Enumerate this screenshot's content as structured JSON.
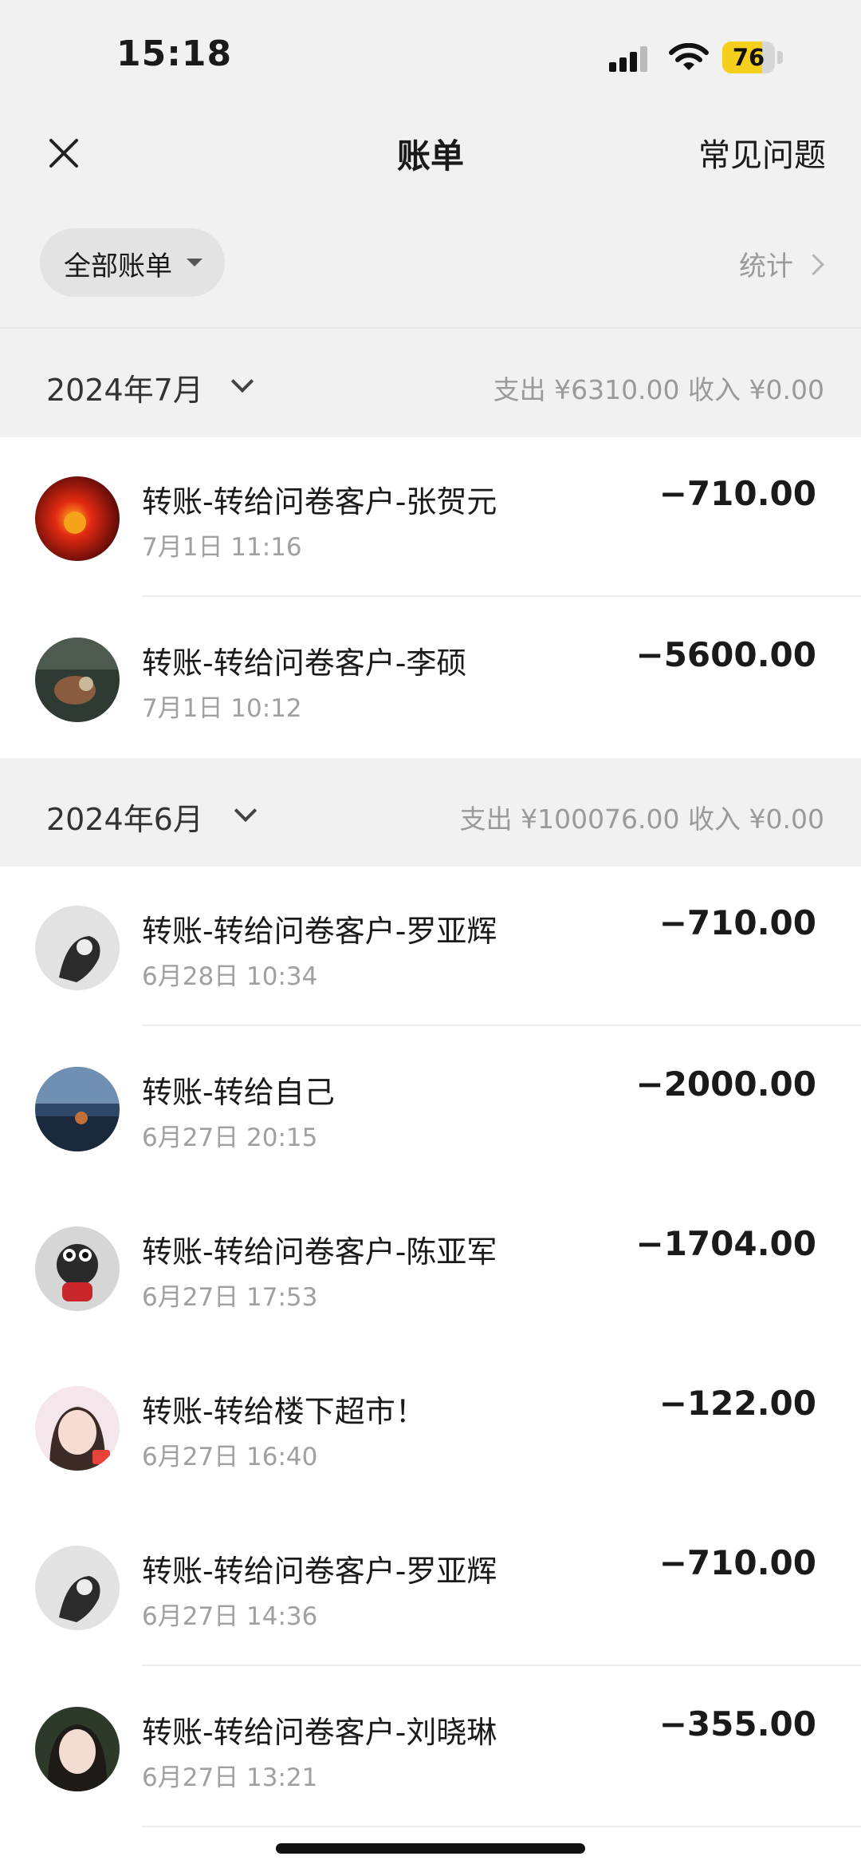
{
  "status_bar": {
    "time": "15:18",
    "battery": "76",
    "battery_level": 0.76
  },
  "nav": {
    "title": "账单",
    "faq": "常见问题"
  },
  "filter": {
    "label": "全部账单",
    "stats": "统计"
  },
  "months": [
    {
      "label": "2024年7月",
      "summary": "支出 ¥6310.00  收入 ¥0.00"
    },
    {
      "label": "2024年6月",
      "summary": "支出 ¥100076.00  收入 ¥0.00"
    }
  ],
  "transactions": [
    {
      "title": "转账-转给问卷客户-张贺元",
      "time": "7月1日 11:16",
      "amount": "−710.00"
    },
    {
      "title": "转账-转给问卷客户-李硕",
      "time": "7月1日 10:12",
      "amount": "−5600.00"
    },
    {
      "title": "转账-转给问卷客户-罗亚辉",
      "time": "6月28日 10:34",
      "amount": "−710.00"
    },
    {
      "title": "转账-转给自己",
      "time": "6月27日 20:15",
      "amount": "−2000.00"
    },
    {
      "title": "转账-转给问卷客户-陈亚军",
      "time": "6月27日 17:53",
      "amount": "−1704.00"
    },
    {
      "title": "转账-转给楼下超市！",
      "time": "6月27日 16:40",
      "amount": "−122.00"
    },
    {
      "title": "转账-转给问卷客户-罗亚辉",
      "time": "6月27日 14:36",
      "amount": "−710.00"
    },
    {
      "title": "转账-转给问卷客户-刘晓琳",
      "time": "6月27日 13:21",
      "amount": "−355.00"
    }
  ],
  "colors": {
    "header_bg": "#f1f1f1",
    "battery": "#f5cf1c",
    "muted": "#9a9a9a"
  }
}
